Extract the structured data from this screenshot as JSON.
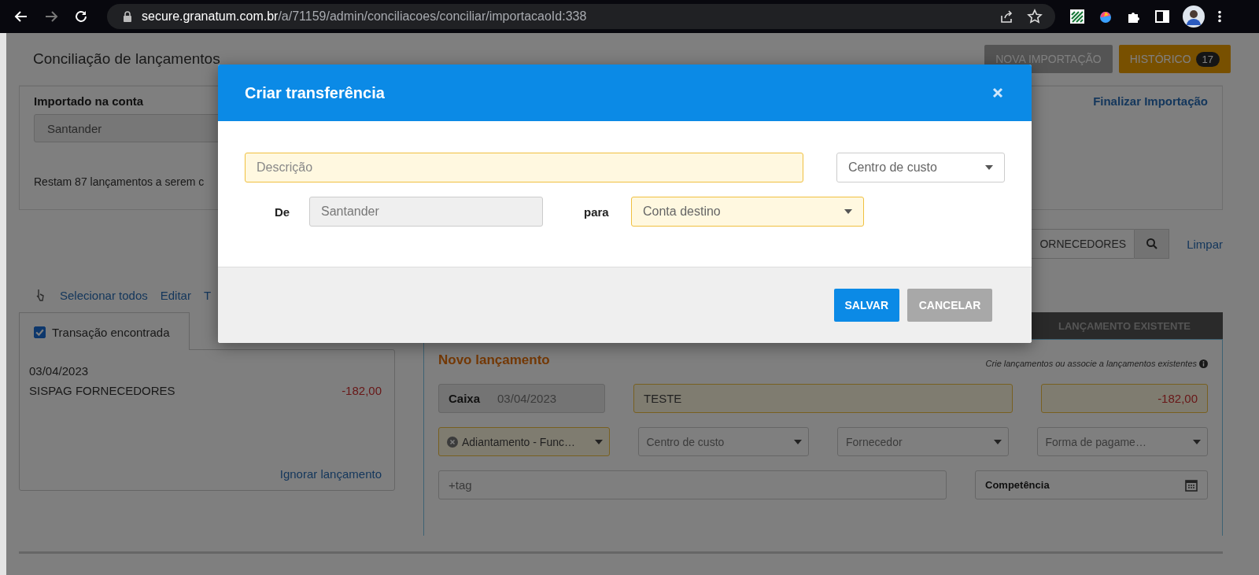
{
  "browser": {
    "url_host": "secure.granatum.com.br",
    "url_path": "/a/71159/admin/conciliacoes/conciliar/importacaoId:338"
  },
  "page": {
    "title": "Conciliação de lançamentos",
    "buttons": [
      {
        "label": "NOVA IMPORTAÇÃO",
        "kind": "secondary"
      },
      {
        "label": "HISTÓRICO",
        "kind": "warning",
        "badge": "17"
      }
    ]
  },
  "import_panel": {
    "label": "Importado na conta",
    "account": "Santander",
    "remaining": "Restam 87 lançamentos a serem c",
    "finish_link": "Finalizar Importação"
  },
  "search": {
    "value": "ORNECEDORES",
    "clear_link": "Limpar"
  },
  "toolbar": {
    "links": [
      "Selecionar todos",
      "Editar",
      "T"
    ]
  },
  "transaction_card": {
    "tab_label": "Transação encontrada",
    "checked": true,
    "date": "03/04/2023",
    "description": "SISPAG FORNECEDORES",
    "amount": "-182,00",
    "ignore_link": "Ignorar lançamento"
  },
  "entry_tabs": [
    {
      "label": "LANÇAMENTO EXISTENTE",
      "selected": false
    }
  ],
  "new_entry": {
    "title": "Novo lançamento",
    "hint": "Crie lançamentos ou associe a lançamentos existentes",
    "account_label": "Caixa",
    "date": "03/04/2023",
    "description": {
      "value": "TESTE",
      "required": true
    },
    "amount": {
      "value": "-182,00",
      "required": true
    },
    "selects": [
      {
        "value": "Adiantamento - Func…",
        "required": true,
        "clearable": true
      },
      {
        "placeholder": "Centro de custo",
        "required": false,
        "clearable": false
      },
      {
        "placeholder": "Fornecedor",
        "required": false,
        "clearable": false
      },
      {
        "placeholder": "Forma de pagame…",
        "required": false,
        "clearable": false
      }
    ],
    "tag_placeholder": "+tag",
    "competence_label": "Competência"
  },
  "modal": {
    "title": "Criar transferência",
    "description": {
      "placeholder": "Descrição",
      "required": true
    },
    "cost_center": {
      "placeholder": "Centro de custo",
      "required": false
    },
    "from_label": "De",
    "from_value": "Santander",
    "to_label": "para",
    "to": {
      "placeholder": "Conta destino",
      "required": true
    },
    "buttons": [
      {
        "label": "SALVAR",
        "kind": "primary"
      },
      {
        "label": "CANCELAR",
        "kind": "secondary"
      }
    ]
  }
}
